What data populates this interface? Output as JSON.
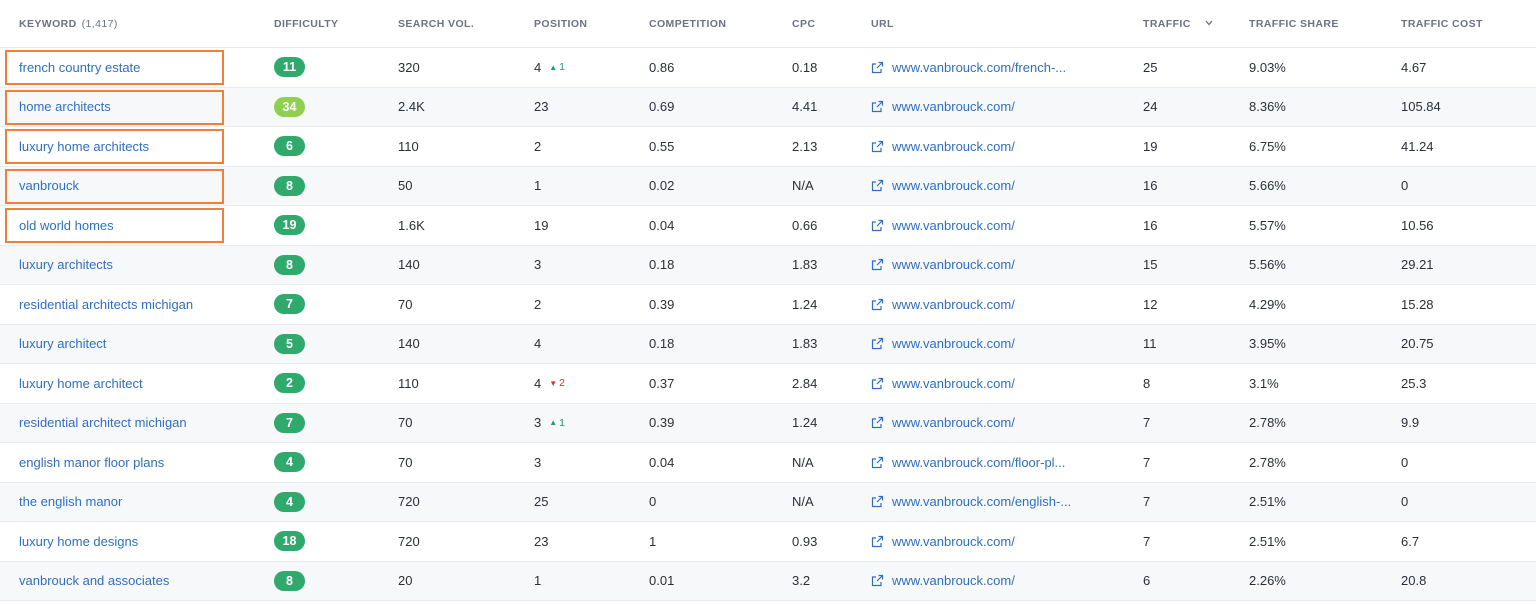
{
  "header": {
    "keyword": "KEYWORD",
    "keyword_count": "(1,417)",
    "difficulty": "DIFFICULTY",
    "search_vol": "SEARCH VOL.",
    "position": "POSITION",
    "competition": "COMPETITION",
    "cpc": "CPC",
    "url": "URL",
    "traffic": "TRAFFIC",
    "traffic_share": "TRAFFIC SHARE",
    "traffic_cost": "TRAFFIC COST"
  },
  "colors": {
    "difficulty_green": "#2fa96c",
    "difficulty_lightgreen": "#8fd14f",
    "highlight": "#f07f3c",
    "link": "#2f6fc0"
  },
  "rows": [
    {
      "keyword": "french country estate",
      "difficulty": "11",
      "diff_level": "green",
      "search_vol": "320",
      "position": "4",
      "pos_change": {
        "dir": "up",
        "value": "1"
      },
      "competition": "0.86",
      "cpc": "0.18",
      "url": "www.vanbrouck.com/french-...",
      "traffic": "25",
      "traffic_share": "9.03%",
      "traffic_cost": "4.67",
      "highlighted": true
    },
    {
      "keyword": "home architects",
      "difficulty": "34",
      "diff_level": "lightgreen",
      "search_vol": "2.4K",
      "position": "23",
      "pos_change": null,
      "competition": "0.69",
      "cpc": "4.41",
      "url": "www.vanbrouck.com/",
      "traffic": "24",
      "traffic_share": "8.36%",
      "traffic_cost": "105.84",
      "highlighted": true
    },
    {
      "keyword": "luxury home architects",
      "difficulty": "6",
      "diff_level": "green",
      "search_vol": "110",
      "position": "2",
      "pos_change": null,
      "competition": "0.55",
      "cpc": "2.13",
      "url": "www.vanbrouck.com/",
      "traffic": "19",
      "traffic_share": "6.75%",
      "traffic_cost": "41.24",
      "highlighted": true
    },
    {
      "keyword": "vanbrouck",
      "difficulty": "8",
      "diff_level": "green",
      "search_vol": "50",
      "position": "1",
      "pos_change": null,
      "competition": "0.02",
      "cpc": "N/A",
      "url": "www.vanbrouck.com/",
      "traffic": "16",
      "traffic_share": "5.66%",
      "traffic_cost": "0",
      "highlighted": true
    },
    {
      "keyword": "old world homes",
      "difficulty": "19",
      "diff_level": "green",
      "search_vol": "1.6K",
      "position": "19",
      "pos_change": null,
      "competition": "0.04",
      "cpc": "0.66",
      "url": "www.vanbrouck.com/",
      "traffic": "16",
      "traffic_share": "5.57%",
      "traffic_cost": "10.56",
      "highlighted": true
    },
    {
      "keyword": "luxury architects",
      "difficulty": "8",
      "diff_level": "green",
      "search_vol": "140",
      "position": "3",
      "pos_change": null,
      "competition": "0.18",
      "cpc": "1.83",
      "url": "www.vanbrouck.com/",
      "traffic": "15",
      "traffic_share": "5.56%",
      "traffic_cost": "29.21",
      "highlighted": false
    },
    {
      "keyword": "residential architects michigan",
      "difficulty": "7",
      "diff_level": "green",
      "search_vol": "70",
      "position": "2",
      "pos_change": null,
      "competition": "0.39",
      "cpc": "1.24",
      "url": "www.vanbrouck.com/",
      "traffic": "12",
      "traffic_share": "4.29%",
      "traffic_cost": "15.28",
      "highlighted": false
    },
    {
      "keyword": "luxury architect",
      "difficulty": "5",
      "diff_level": "green",
      "search_vol": "140",
      "position": "4",
      "pos_change": null,
      "competition": "0.18",
      "cpc": "1.83",
      "url": "www.vanbrouck.com/",
      "traffic": "11",
      "traffic_share": "3.95%",
      "traffic_cost": "20.75",
      "highlighted": false
    },
    {
      "keyword": "luxury home architect",
      "difficulty": "2",
      "diff_level": "green",
      "search_vol": "110",
      "position": "4",
      "pos_change": {
        "dir": "down",
        "value": "2"
      },
      "competition": "0.37",
      "cpc": "2.84",
      "url": "www.vanbrouck.com/",
      "traffic": "8",
      "traffic_share": "3.1%",
      "traffic_cost": "25.3",
      "highlighted": false
    },
    {
      "keyword": "residential architect michigan",
      "difficulty": "7",
      "diff_level": "green",
      "search_vol": "70",
      "position": "3",
      "pos_change": {
        "dir": "up",
        "value": "1"
      },
      "competition": "0.39",
      "cpc": "1.24",
      "url": "www.vanbrouck.com/",
      "traffic": "7",
      "traffic_share": "2.78%",
      "traffic_cost": "9.9",
      "highlighted": false
    },
    {
      "keyword": "english manor floor plans",
      "difficulty": "4",
      "diff_level": "green",
      "search_vol": "70",
      "position": "3",
      "pos_change": null,
      "competition": "0.04",
      "cpc": "N/A",
      "url": "www.vanbrouck.com/floor-pl...",
      "traffic": "7",
      "traffic_share": "2.78%",
      "traffic_cost": "0",
      "highlighted": false
    },
    {
      "keyword": "the english manor",
      "difficulty": "4",
      "diff_level": "green",
      "search_vol": "720",
      "position": "25",
      "pos_change": null,
      "competition": "0",
      "cpc": "N/A",
      "url": "www.vanbrouck.com/english-...",
      "traffic": "7",
      "traffic_share": "2.51%",
      "traffic_cost": "0",
      "highlighted": false
    },
    {
      "keyword": "luxury home designs",
      "difficulty": "18",
      "diff_level": "green",
      "search_vol": "720",
      "position": "23",
      "pos_change": null,
      "competition": "1",
      "cpc": "0.93",
      "url": "www.vanbrouck.com/",
      "traffic": "7",
      "traffic_share": "2.51%",
      "traffic_cost": "6.7",
      "highlighted": false
    },
    {
      "keyword": "vanbrouck and associates",
      "difficulty": "8",
      "diff_level": "green",
      "search_vol": "20",
      "position": "1",
      "pos_change": null,
      "competition": "0.01",
      "cpc": "3.2",
      "url": "www.vanbrouck.com/",
      "traffic": "6",
      "traffic_share": "2.26%",
      "traffic_cost": "20.8",
      "highlighted": false
    }
  ]
}
